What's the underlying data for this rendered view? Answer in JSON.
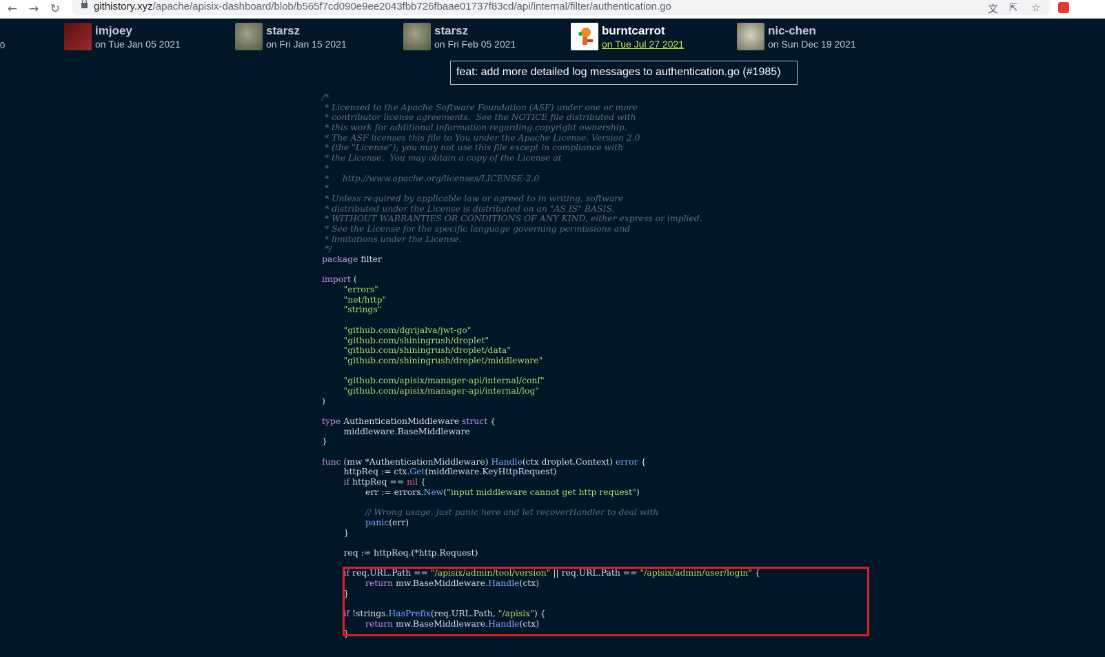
{
  "browser": {
    "back_icon": "arrow-left-icon",
    "forward_icon": "arrow-right-icon",
    "reload_icon": "reload-icon",
    "url_host": "githistory.xyz",
    "url_path": "/apache/apisix-dashboard/blob/b565f7cd090e9ee2043fbb726fbaae01737f83cd/api/internal/filter/authentication.go"
  },
  "edge_digit": "0",
  "authors": [
    {
      "name": "imjoey",
      "date": "on Tue Jan 05 2021",
      "avatar_color": "#7a1f1f",
      "active": false
    },
    {
      "name": "starsz",
      "date": "on Fri Jan 15 2021",
      "avatar_color": "#6f7d5e",
      "active": false
    },
    {
      "name": "starsz",
      "date": "on Fri Feb 05 2021",
      "avatar_color": "#6f7d5e",
      "active": false
    },
    {
      "name": "burntcarrot",
      "date": "on Tue Jul 27 2021",
      "avatar_color": "#ffffff",
      "active": true
    },
    {
      "name": "nic-chen",
      "date": "on Sun Dec 19 2021",
      "avatar_color": "#8d8f7a",
      "active": false
    }
  ],
  "commit_tooltip": "feat: add more detailed log messages to authentication.go (#1985)",
  "code_lines": [
    [
      {
        "t": "/*",
        "c": "cm"
      }
    ],
    [
      {
        "t": " * Licensed to the Apache Software Foundation (ASF) under one or more",
        "c": "cm"
      }
    ],
    [
      {
        "t": " * contributor license agreements.  See the NOTICE file distributed with",
        "c": "cm"
      }
    ],
    [
      {
        "t": " * this work for additional information regarding copyright ownership.",
        "c": "cm"
      }
    ],
    [
      {
        "t": " * The ASF licenses this file to You under the Apache License, Version 2.0",
        "c": "cm"
      }
    ],
    [
      {
        "t": " * (the \"License\"); you may not use this file except in compliance with",
        "c": "cm"
      }
    ],
    [
      {
        "t": " * the License.  You may obtain a copy of the License at",
        "c": "cm"
      }
    ],
    [
      {
        "t": " *",
        "c": "cm"
      }
    ],
    [
      {
        "t": " *     http://www.apache.org/licenses/LICENSE-2.0",
        "c": "cm"
      }
    ],
    [
      {
        "t": " *",
        "c": "cm"
      }
    ],
    [
      {
        "t": " * Unless required by applicable law or agreed to in writing, software",
        "c": "cm"
      }
    ],
    [
      {
        "t": " * distributed under the License is distributed on an \"AS IS\" BASIS,",
        "c": "cm"
      }
    ],
    [
      {
        "t": " * WITHOUT WARRANTIES OR CONDITIONS OF ANY KIND, either express or implied.",
        "c": "cm"
      }
    ],
    [
      {
        "t": " * See the License for the specific language governing permissions and",
        "c": "cm"
      }
    ],
    [
      {
        "t": " * limitations under the License.",
        "c": "cm"
      }
    ],
    [
      {
        "t": " */",
        "c": "cm"
      }
    ],
    [
      {
        "t": "package",
        "c": "kw"
      },
      {
        "t": " filter",
        "c": ""
      }
    ],
    [],
    [
      {
        "t": "import",
        "c": "kw"
      },
      {
        "t": " (",
        "c": ""
      }
    ],
    [
      {
        "t": "        ",
        "c": ""
      },
      {
        "t": "\"errors\"",
        "c": "str"
      }
    ],
    [
      {
        "t": "        ",
        "c": ""
      },
      {
        "t": "\"net/http\"",
        "c": "str"
      }
    ],
    [
      {
        "t": "        ",
        "c": ""
      },
      {
        "t": "\"strings\"",
        "c": "str"
      }
    ],
    [],
    [
      {
        "t": "        ",
        "c": ""
      },
      {
        "t": "\"github.com/dgrijalva/jwt-go\"",
        "c": "str"
      }
    ],
    [
      {
        "t": "        ",
        "c": ""
      },
      {
        "t": "\"github.com/shiningrush/droplet\"",
        "c": "str"
      }
    ],
    [
      {
        "t": "        ",
        "c": ""
      },
      {
        "t": "\"github.com/shiningrush/droplet/data\"",
        "c": "str"
      }
    ],
    [
      {
        "t": "        ",
        "c": ""
      },
      {
        "t": "\"github.com/shiningrush/droplet/middleware\"",
        "c": "str"
      }
    ],
    [],
    [
      {
        "t": "        ",
        "c": ""
      },
      {
        "t": "\"github.com/apisix/manager-api/internal/conf\"",
        "c": "str"
      }
    ],
    [
      {
        "t": "        ",
        "c": ""
      },
      {
        "t": "\"github.com/apisix/manager-api/internal/log\"",
        "c": "str"
      }
    ],
    [
      {
        "t": ")",
        "c": ""
      }
    ],
    [],
    [
      {
        "t": "type",
        "c": "kw"
      },
      {
        "t": " AuthenticationMiddleware ",
        "c": ""
      },
      {
        "t": "struct",
        "c": "kw"
      },
      {
        "t": " {",
        "c": ""
      }
    ],
    [
      {
        "t": "        middleware.BaseMiddleware",
        "c": ""
      }
    ],
    [
      {
        "t": "}",
        "c": ""
      }
    ],
    [],
    [
      {
        "t": "func",
        "c": "kw"
      },
      {
        "t": " (mw *AuthenticationMiddleware) ",
        "c": ""
      },
      {
        "t": "Handle",
        "c": "fn"
      },
      {
        "t": "(ctx droplet.Context) ",
        "c": ""
      },
      {
        "t": "error",
        "c": "fn"
      },
      {
        "t": " {",
        "c": ""
      }
    ],
    [
      {
        "t": "        httpReq := ctx.",
        "c": ""
      },
      {
        "t": "Get",
        "c": "fn"
      },
      {
        "t": "(middleware.KeyHttpRequest)",
        "c": ""
      }
    ],
    [
      {
        "t": "        ",
        "c": ""
      },
      {
        "t": "if",
        "c": "kw"
      },
      {
        "t": " httpReq == ",
        "c": ""
      },
      {
        "t": "nil",
        "c": "nil"
      },
      {
        "t": " {",
        "c": ""
      }
    ],
    [
      {
        "t": "                err := errors.",
        "c": ""
      },
      {
        "t": "New",
        "c": "fn"
      },
      {
        "t": "(",
        "c": ""
      },
      {
        "t": "\"input middleware cannot get http request\"",
        "c": "str"
      },
      {
        "t": ")",
        "c": ""
      }
    ],
    [],
    [
      {
        "t": "                ",
        "c": ""
      },
      {
        "t": "// Wrong usage, just panic here and let recoverHandler to deal with",
        "c": "cm"
      }
    ],
    [
      {
        "t": "                ",
        "c": ""
      },
      {
        "t": "panic",
        "c": "fn"
      },
      {
        "t": "(err)",
        "c": ""
      }
    ],
    [
      {
        "t": "        }",
        "c": ""
      }
    ],
    [],
    [
      {
        "t": "        req := httpReq.(*http.Request)",
        "c": ""
      }
    ],
    [],
    [
      {
        "t": "        ",
        "c": ""
      },
      {
        "t": "if",
        "c": "kw"
      },
      {
        "t": " req.URL.Path == ",
        "c": ""
      },
      {
        "t": "\"/apisix/admin/tool/version\"",
        "c": "str"
      },
      {
        "t": " || req.URL.Path == ",
        "c": ""
      },
      {
        "t": "\"/apisix/admin/user/login\"",
        "c": "str"
      },
      {
        "t": " {",
        "c": ""
      }
    ],
    [
      {
        "t": "                ",
        "c": ""
      },
      {
        "t": "return",
        "c": "kw"
      },
      {
        "t": " mw.BaseMiddleware.",
        "c": ""
      },
      {
        "t": "Handle",
        "c": "fn"
      },
      {
        "t": "(ctx)",
        "c": ""
      }
    ],
    [
      {
        "t": "        }",
        "c": ""
      }
    ],
    [],
    [
      {
        "t": "        ",
        "c": ""
      },
      {
        "t": "if",
        "c": "kw"
      },
      {
        "t": " !strings.",
        "c": ""
      },
      {
        "t": "HasPrefix",
        "c": "fn"
      },
      {
        "t": "(req.URL.Path, ",
        "c": ""
      },
      {
        "t": "\"/apisix\"",
        "c": "str"
      },
      {
        "t": ") {",
        "c": ""
      }
    ],
    [
      {
        "t": "                ",
        "c": ""
      },
      {
        "t": "return",
        "c": "kw"
      },
      {
        "t": " mw.BaseMiddleware.",
        "c": ""
      },
      {
        "t": "Handle",
        "c": "fn"
      },
      {
        "t": "(ctx)",
        "c": ""
      }
    ],
    [
      {
        "t": "        }",
        "c": ""
      }
    ]
  ]
}
